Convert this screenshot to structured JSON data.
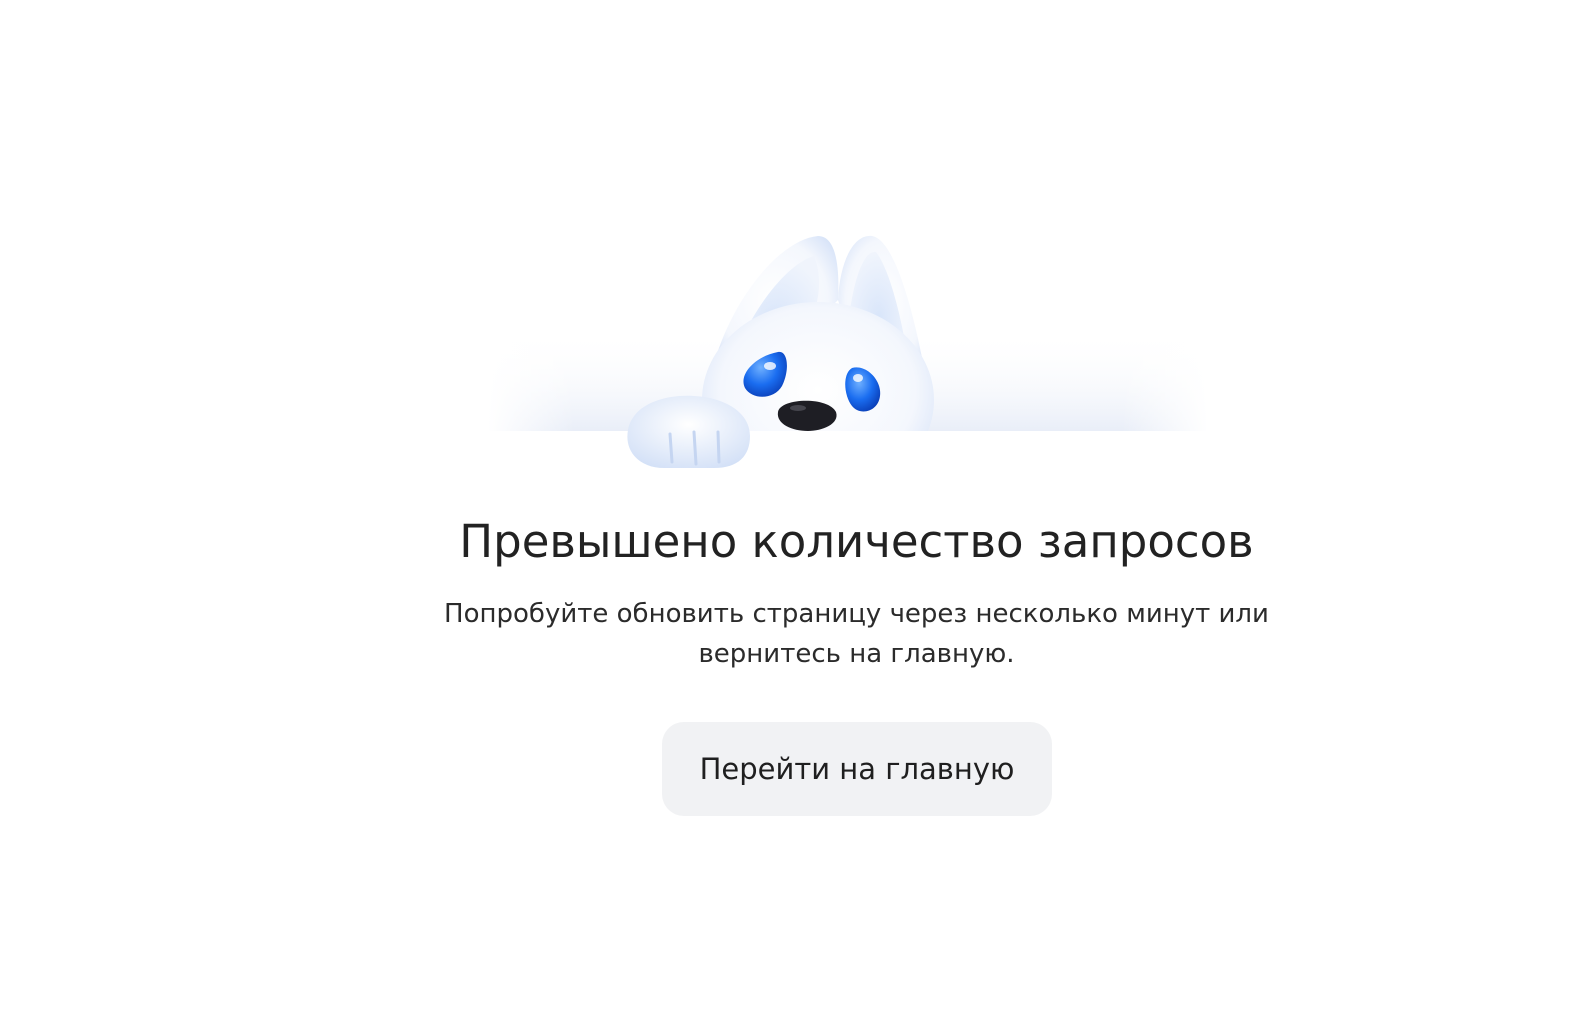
{
  "error": {
    "title": "Превышено количество запросов",
    "message_line1": "Попробуйте обновить страницу через несколько минут или",
    "message_line2": "вернитесь на главную."
  },
  "actions": {
    "home_button_label": "Перейти на главную"
  },
  "illustration": {
    "icon": "sad-white-dog-mascot",
    "eye_color": "#1a6df0",
    "nose_color": "#1e1e24"
  },
  "colors": {
    "background": "#ffffff",
    "button_background": "#f1f2f4",
    "text": "#222222"
  }
}
